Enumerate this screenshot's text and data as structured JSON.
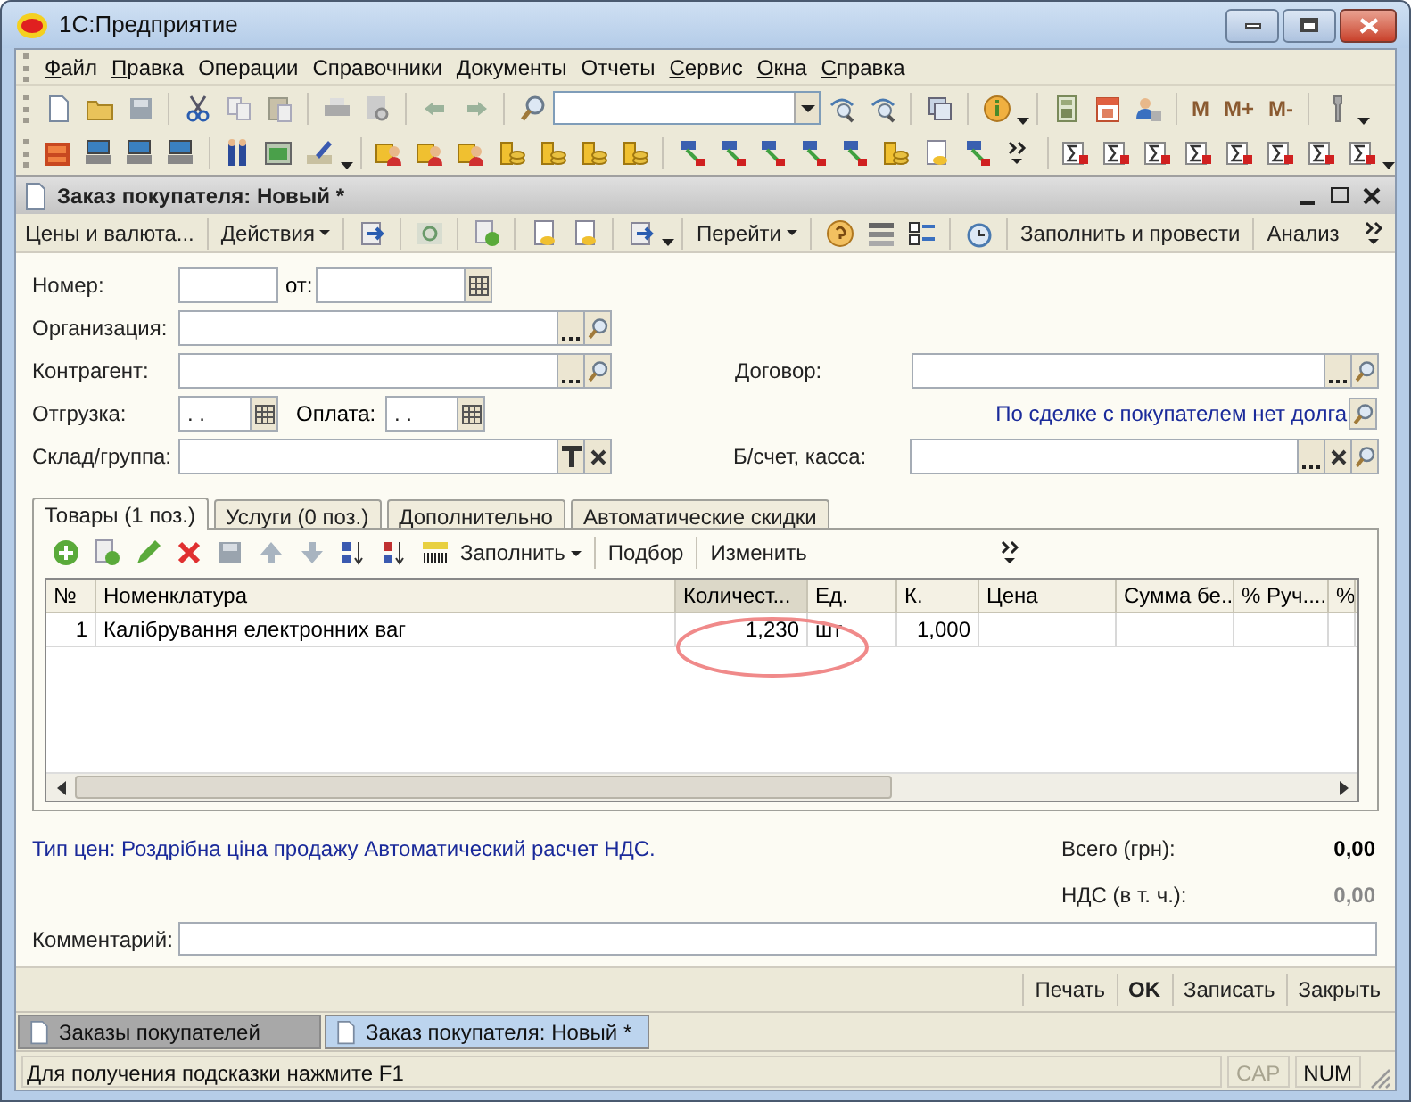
{
  "window": {
    "title": "1С:Предприятие"
  },
  "menu": [
    {
      "label": "Файл",
      "underlined": true
    },
    {
      "label": "Правка",
      "underlined": true
    },
    {
      "label": "Операции",
      "underlined": false
    },
    {
      "label": "Справочники",
      "underlined": false
    },
    {
      "label": "Документы",
      "underlined": false
    },
    {
      "label": "Отчеты",
      "underlined": false
    },
    {
      "label": "Сервис",
      "underlined": true
    },
    {
      "label": "Окна",
      "underlined": true
    },
    {
      "label": "Справка",
      "underlined": true
    }
  ],
  "memory_buttons": [
    "M",
    "M+",
    "M-"
  ],
  "document": {
    "title": "Заказ покупателя: Новый *",
    "command_bar": [
      {
        "label": "Цены и валюта...",
        "dropdown": false
      },
      {
        "label": "Действия",
        "dropdown": true
      },
      {
        "label": "Перейти",
        "dropdown": true
      },
      {
        "label": "Заполнить и провести",
        "dropdown": false
      },
      {
        "label": "Анализ",
        "dropdown": false
      }
    ],
    "fields": {
      "number": {
        "label": "Номер:"
      },
      "date": {
        "label": "от:"
      },
      "organization": {
        "label": "Организация:"
      },
      "counterparty": {
        "label": "Контрагент:"
      },
      "contract": {
        "label": "Договор:"
      },
      "shipment": {
        "label": "Отгрузка:",
        "value": ". ."
      },
      "payment": {
        "label": "Оплата:",
        "value": ". ."
      },
      "debt_link": "По сделке с покупателем нет долга",
      "warehouse": {
        "label": "Склад/группа:"
      },
      "account": {
        "label": "Б/счет, касса:"
      }
    },
    "tabs": [
      {
        "label": "Товары (1 поз.)",
        "selected": true
      },
      {
        "label": "Услуги (0 поз.)",
        "selected": false
      },
      {
        "label": "Дополнительно",
        "selected": false
      },
      {
        "label": "Автоматические скидки",
        "selected": false
      }
    ],
    "table_toolbar": [
      {
        "label": "Заполнить",
        "dropdown": true
      },
      {
        "label": "Подбор",
        "dropdown": false
      },
      {
        "label": "Изменить",
        "dropdown": false
      }
    ],
    "table": {
      "columns": [
        {
          "label": "№",
          "highlighted": false
        },
        {
          "label": "Номенклатура",
          "highlighted": false
        },
        {
          "label": "Количест...",
          "highlighted": true
        },
        {
          "label": "Ед.",
          "highlighted": false
        },
        {
          "label": "К.",
          "highlighted": false
        },
        {
          "label": "Цена",
          "highlighted": false
        },
        {
          "label": "Сумма бе...",
          "highlighted": false
        },
        {
          "label": "% Руч....",
          "highlighted": false
        },
        {
          "label": "%",
          "highlighted": false
        }
      ],
      "rows": [
        {
          "cells": [
            "1",
            "Калібрування електронних ваг",
            "1,230",
            "шт",
            "1,000"
          ]
        }
      ]
    },
    "price_info": "Тип цен: Роздрібна ціна продажу Автоматический расчет НДС.",
    "totals": [
      {
        "label": "Всего (грн):",
        "value": "0,00",
        "emphasis": true
      },
      {
        "label": "НДС (в т. ч.):",
        "value": "0,00",
        "emphasis": false
      }
    ],
    "comment": {
      "label": "Комментарий:"
    },
    "buttons": [
      {
        "label": "Печать",
        "default": false
      },
      {
        "label": "OK",
        "default": true
      },
      {
        "label": "Записать",
        "default": false
      },
      {
        "label": "Закрыть",
        "default": false
      }
    ]
  },
  "window_tabs": [
    {
      "label": "Заказы покупателей",
      "selected": false
    },
    {
      "label": "Заказ покупателя: Новый *",
      "selected": true
    }
  ],
  "status_bar": {
    "text": "Для получения подсказки нажмите F1",
    "indicators": [
      {
        "label": "CAP",
        "on": false
      },
      {
        "label": "NUM",
        "on": true
      }
    ]
  }
}
